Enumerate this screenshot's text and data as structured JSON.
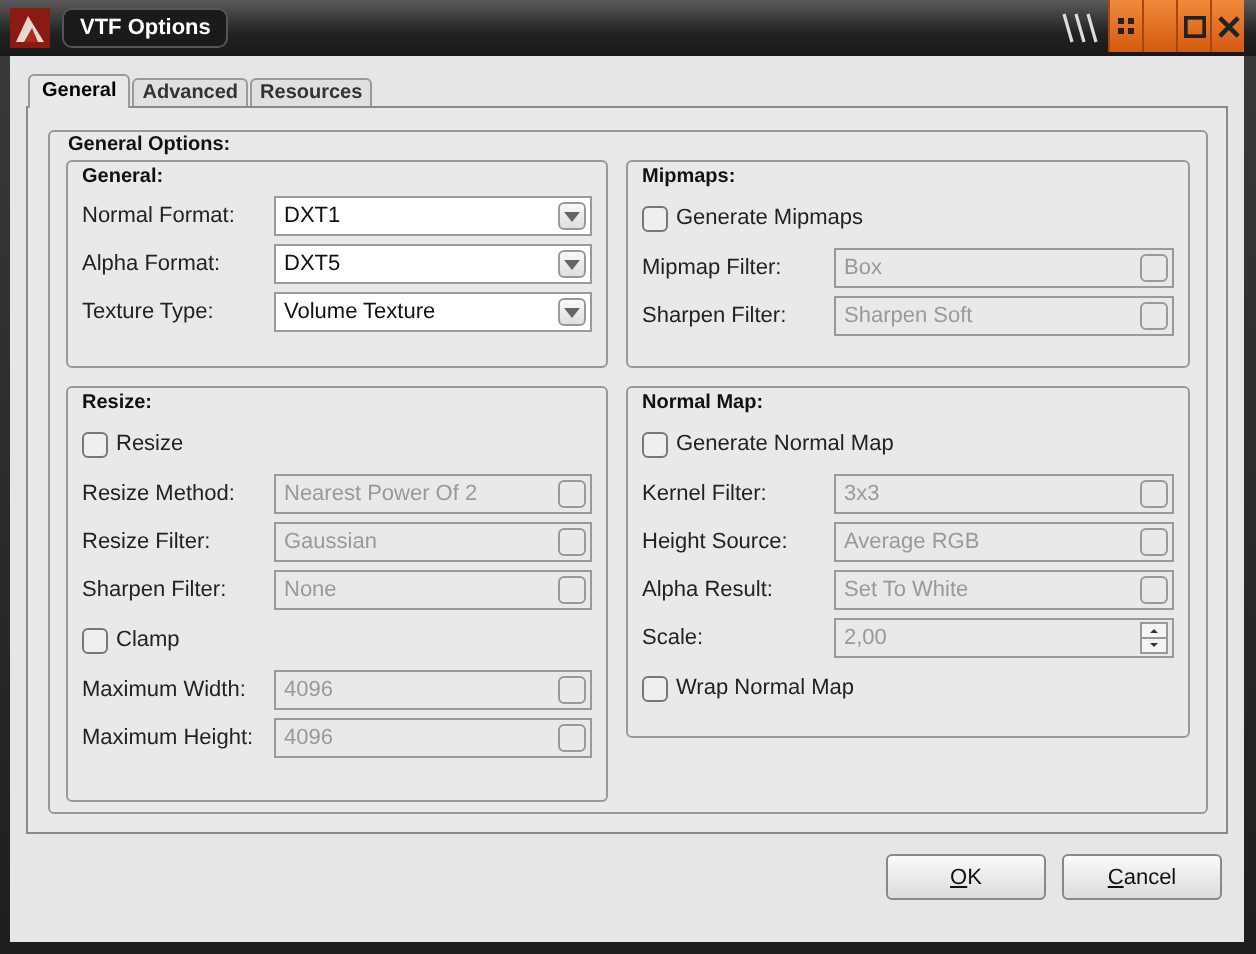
{
  "window": {
    "title": "VTF Options"
  },
  "tabs": [
    {
      "label": "General",
      "selected": true
    },
    {
      "label": "Advanced",
      "selected": false
    },
    {
      "label": "Resources",
      "selected": false
    }
  ],
  "panel": {
    "title": "General Options:",
    "columns": [
      [
        {
          "title": "General:",
          "rows": [
            {
              "kind": "dropdown",
              "label": "Normal Format:",
              "value": "DXT1",
              "disabled": false
            },
            {
              "kind": "dropdown",
              "label": "Alpha Format:",
              "value": "DXT5",
              "disabled": false
            },
            {
              "kind": "dropdown",
              "label": "Texture Type:",
              "value": "Volume Texture",
              "disabled": false
            }
          ]
        },
        {
          "title": "Resize:",
          "rows": [
            {
              "kind": "checkbox",
              "label": "Resize",
              "checked": false
            },
            {
              "kind": "dropdown",
              "label": "Resize Method:",
              "value": "Nearest Power Of 2",
              "disabled": true
            },
            {
              "kind": "dropdown",
              "label": "Resize Filter:",
              "value": "Gaussian",
              "disabled": true
            },
            {
              "kind": "dropdown",
              "label": "Sharpen Filter:",
              "value": "None",
              "disabled": true
            },
            {
              "kind": "checkbox",
              "label": "Clamp",
              "checked": false
            },
            {
              "kind": "dropdown",
              "label": "Maximum Width:",
              "value": "4096",
              "disabled": true
            },
            {
              "kind": "dropdown",
              "label": "Maximum Height:",
              "value": "4096",
              "disabled": true
            }
          ]
        }
      ],
      [
        {
          "title": "Mipmaps:",
          "rows": [
            {
              "kind": "checkbox",
              "label": "Generate Mipmaps",
              "checked": false
            },
            {
              "kind": "dropdown",
              "label": "Mipmap Filter:",
              "value": "Box",
              "disabled": true
            },
            {
              "kind": "dropdown",
              "label": "Sharpen Filter:",
              "value": "Sharpen Soft",
              "disabled": true
            }
          ]
        },
        {
          "title": "Normal Map:",
          "rows": [
            {
              "kind": "checkbox",
              "label": "Generate Normal Map",
              "checked": false
            },
            {
              "kind": "dropdown",
              "label": "Kernel Filter:",
              "value": "3x3",
              "disabled": true
            },
            {
              "kind": "dropdown",
              "label": "Height Source:",
              "value": "Average RGB",
              "disabled": true
            },
            {
              "kind": "dropdown",
              "label": "Alpha Result:",
              "value": "Set To White",
              "disabled": true
            },
            {
              "kind": "spin",
              "label": "Scale:",
              "value": "2,00",
              "disabled": true
            },
            {
              "kind": "checkbox",
              "label": "Wrap Normal Map",
              "checked": false
            }
          ]
        }
      ]
    ]
  },
  "buttons": [
    "OK",
    "Cancel"
  ]
}
